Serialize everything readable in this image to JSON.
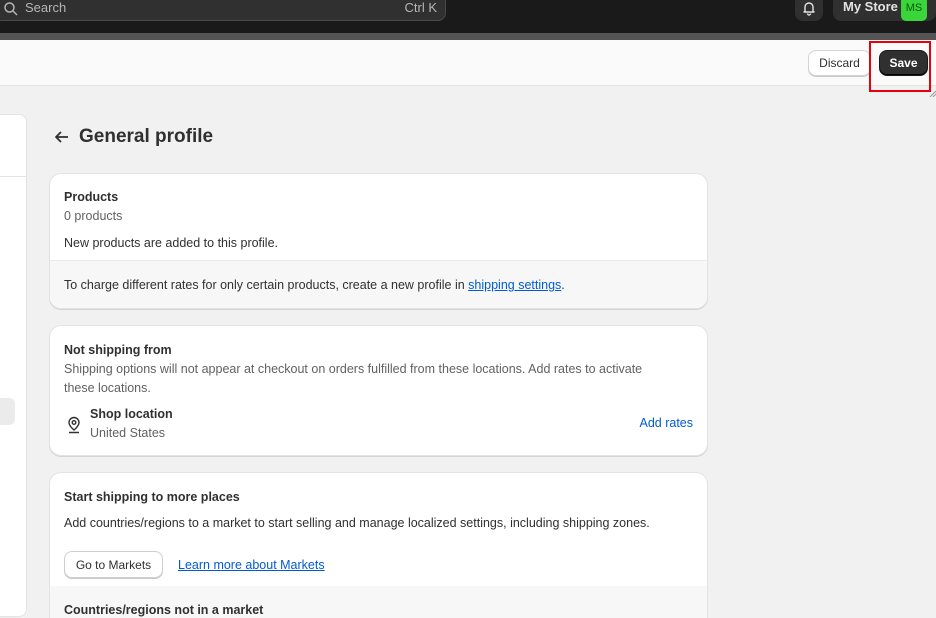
{
  "topbar": {
    "search_placeholder": "Search",
    "search_shortcut": "Ctrl K",
    "store_name": "My Store",
    "avatar_initials": "MS"
  },
  "savebar": {
    "discard_label": "Discard",
    "save_label": "Save"
  },
  "page": {
    "title": "General profile"
  },
  "products_card": {
    "heading": "Products",
    "count": "0 products",
    "note": "New products are added to this profile.",
    "footer_prefix": "To charge different rates for only certain products, create a new profile in ",
    "footer_link": "shipping settings",
    "footer_suffix": "."
  },
  "not_shipping_card": {
    "heading": "Not shipping from",
    "description_line1": "Shipping options will not appear at checkout on orders fulfilled from these locations. Add rates to activate",
    "description_line2": "these locations.",
    "location_name": "Shop location",
    "location_country": "United States",
    "add_rates_label": "Add rates"
  },
  "markets_card": {
    "heading": "Start shipping to more places",
    "description": "Add countries/regions to a market to start selling and manage localized settings, including shipping zones.",
    "go_to_markets_label": "Go to Markets",
    "learn_more_label": "Learn more about Markets",
    "footer_heading": "Countries/regions not in a market"
  },
  "icons": {
    "search": "search-icon",
    "bell": "bell-icon",
    "back": "arrow-left-icon",
    "pin": "location-pin-icon"
  },
  "colors": {
    "topbar": "#1a1a1a",
    "save_button": "#303030",
    "link": "#005bd3",
    "avatar": "#3ad53a",
    "highlight": "#e8000b"
  }
}
